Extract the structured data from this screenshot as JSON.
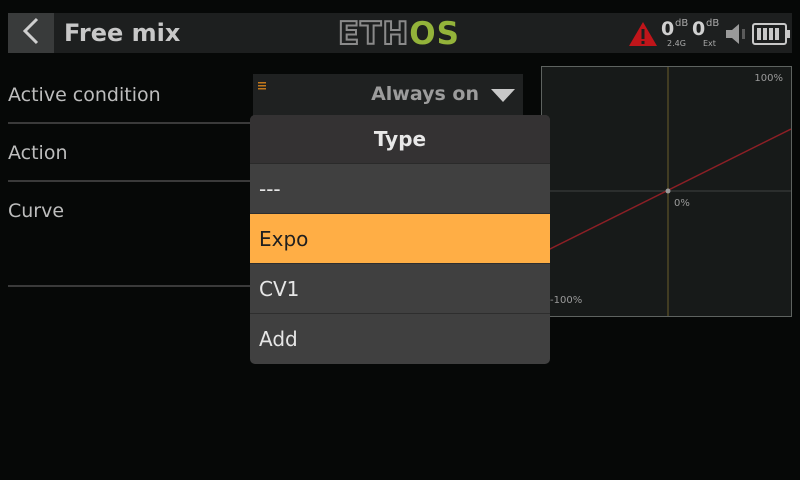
{
  "header": {
    "title": "Free mix",
    "logo_left": "ETH",
    "logo_right": "OS",
    "rssi_24": {
      "value": "0",
      "unit": "dB",
      "label": "2.4G"
    },
    "rssi_ext": {
      "value": "0",
      "unit": "dB",
      "label": "Ext"
    }
  },
  "rows": {
    "active_condition": {
      "label": "Active condition",
      "value": "Always on"
    },
    "action": {
      "label": "Action"
    },
    "curve": {
      "label": "Curve"
    }
  },
  "curve_graph": {
    "top_label": "100%",
    "center_label": "0%",
    "bottom_label": "-100%"
  },
  "popup": {
    "title": "Type",
    "options": [
      "---",
      "Expo",
      "CV1",
      "Add"
    ],
    "selected": "Expo"
  },
  "colors": {
    "accent": "#ffae45",
    "logo_green": "#93b33a",
    "warning": "#c0151a",
    "curve_line": "#8c1f25"
  }
}
